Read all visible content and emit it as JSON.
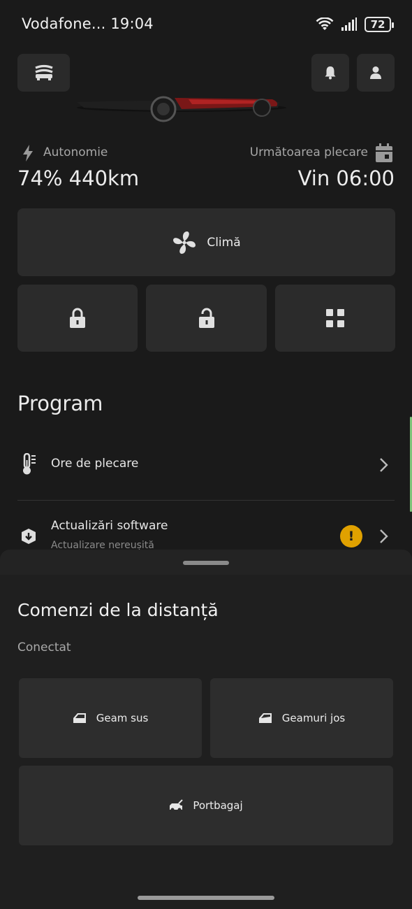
{
  "status_bar": {
    "carrier_time": "Vodafone... 19:04",
    "battery": "72"
  },
  "stats": {
    "range_label": "Autonomie",
    "range_value": "74% 440km",
    "next_departure_label": "Următoarea plecare",
    "next_departure_value": "Vin 06:00"
  },
  "actions": {
    "climate_label": "Climă"
  },
  "program": {
    "title": "Program",
    "items": [
      {
        "label": "Ore de plecare"
      },
      {
        "label": "Actualizări software",
        "sublabel": "Actualizare nereușită",
        "badge": "!"
      }
    ]
  },
  "remote": {
    "title": "Comenzi de la distanță",
    "status": "Conectat",
    "window_up": "Geam sus",
    "windows_down": "Geamuri jos",
    "trunk": "Portbagaj"
  },
  "colors": {
    "background": "#1a1a1a",
    "tile": "#2b2b2b",
    "warning": "#e0a100",
    "accent": "#7fc47a"
  }
}
